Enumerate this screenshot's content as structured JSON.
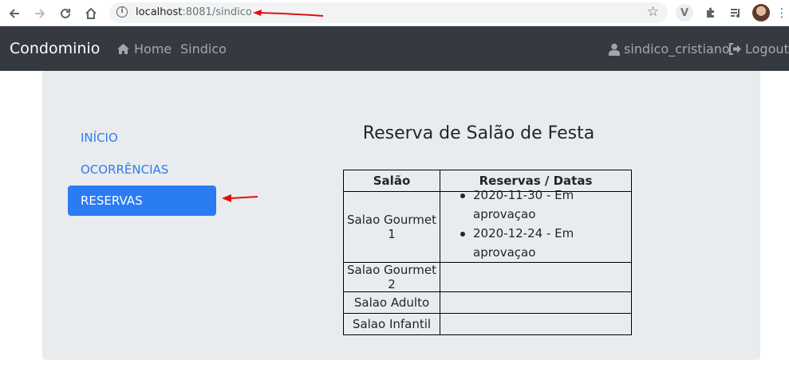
{
  "browser": {
    "url_host": "localhost",
    "url_port_path": ":8081/sindico"
  },
  "navbar": {
    "brand": "Condominio",
    "home": "Home",
    "sindico": "Sindico",
    "user": "sindico_cristiano",
    "logout": "Logout"
  },
  "sidebar": {
    "items": [
      {
        "label": "INÍCIO",
        "active": false
      },
      {
        "label": "OCORRÊNCIAS",
        "active": false
      },
      {
        "label": "RESERVAS",
        "active": true
      }
    ]
  },
  "main": {
    "title": "Reserva de Salão de Festa",
    "table": {
      "headers": [
        "Salão",
        "Reservas / Datas"
      ],
      "rows": [
        {
          "salao": "Salao Gourmet 1",
          "reservas": [
            "2020-11-30 - Em aprovaçao",
            "2020-12-24 - Em aprovaçao"
          ]
        },
        {
          "salao": "Salao Gourmet 2",
          "reservas": []
        },
        {
          "salao": "Salao Adulto",
          "reservas": []
        },
        {
          "salao": "Salao Infantil",
          "reservas": []
        }
      ]
    }
  },
  "colors": {
    "navbar_bg": "#343a40",
    "card_bg": "#e9ecef",
    "active_item_bg": "#2b7bf3",
    "link": "#2f7ce9",
    "annotation_arrow": "#e01010"
  }
}
